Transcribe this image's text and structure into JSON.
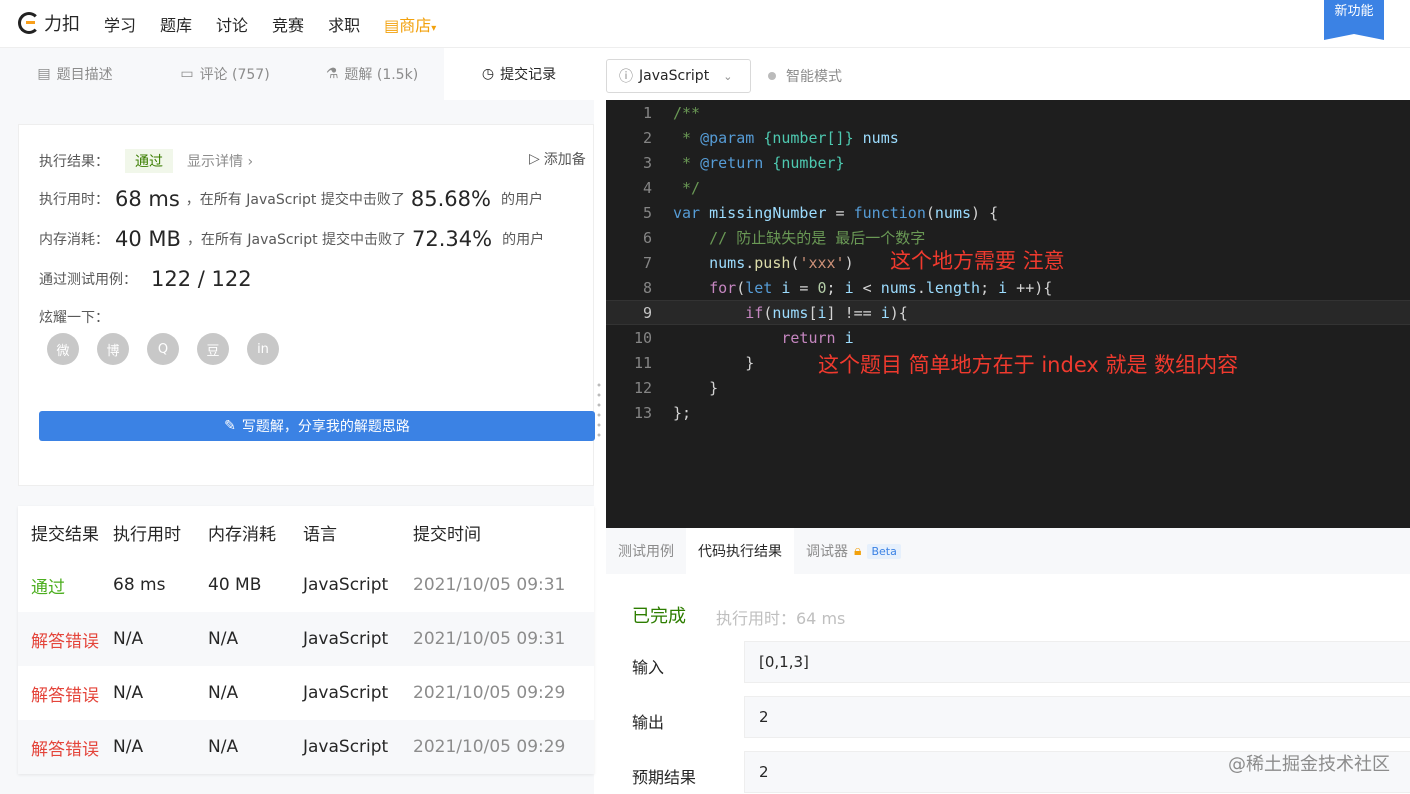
{
  "header": {
    "logo_text": "力扣",
    "nav": [
      "学习",
      "题库",
      "讨论",
      "竞赛",
      "求职"
    ],
    "shop_label": "商店",
    "new_feature": "新功能"
  },
  "left_tabs": [
    {
      "label": "题目描述",
      "icon": "doc-icon"
    },
    {
      "label": "评论 (757)",
      "icon": "comment-icon"
    },
    {
      "label": "题解 (1.5k)",
      "icon": "flask-icon"
    },
    {
      "label": "提交记录",
      "icon": "clock-icon"
    }
  ],
  "result_panel": {
    "exec_result_label": "执行结果：",
    "exec_result_value": "通过",
    "show_details": "显示详情",
    "add_note": "添加备",
    "time_label": "执行用时：",
    "time_value": "68 ms",
    "time_text": "，在所有 JavaScript 提交中击败了",
    "time_percent": "85.68%",
    "time_suffix": "的用户",
    "mem_label": "内存消耗：",
    "mem_value": "40 MB",
    "mem_text": "，在所有 JavaScript 提交中击败了",
    "mem_percent": "72.34%",
    "mem_suffix": "的用户",
    "cases_label": "通过测试用例：",
    "cases_value": "122 / 122",
    "share_label": "炫耀一下：",
    "social": [
      "微",
      "博",
      "Q",
      "豆",
      "in"
    ],
    "write_button": "写题解，分享我的解题思路"
  },
  "submissions": {
    "headers": [
      "提交结果",
      "执行用时",
      "内存消耗",
      "语言",
      "提交时间"
    ],
    "rows": [
      {
        "status": "通过",
        "time": "68 ms",
        "mem": "40 MB",
        "lang": "JavaScript",
        "date": "2021/10/05 09:31"
      },
      {
        "status": "解答错误",
        "time": "N/A",
        "mem": "N/A",
        "lang": "JavaScript",
        "date": "2021/10/05 09:31"
      },
      {
        "status": "解答错误",
        "time": "N/A",
        "mem": "N/A",
        "lang": "JavaScript",
        "date": "2021/10/05 09:29"
      },
      {
        "status": "解答错误",
        "time": "N/A",
        "mem": "N/A",
        "lang": "JavaScript",
        "date": "2021/10/05 09:29"
      }
    ]
  },
  "editor": {
    "language": "JavaScript",
    "smart_mode": "智能模式",
    "line_numbers": [
      "1",
      "2",
      "3",
      "4",
      "5",
      "6",
      "7",
      "8",
      "9",
      "10",
      "11",
      "12",
      "13"
    ],
    "annotation_1": "这个地方需要 注意",
    "annotation_2": "这个题目 简单地方在于 index 就是 数组内容"
  },
  "bottom_tabs": [
    "测试用例",
    "代码执行结果",
    "调试器",
    "Beta"
  ],
  "run_result": {
    "status": "已完成",
    "runtime": "执行用时：64 ms",
    "input_label": "输入",
    "input_value": "[0,1,3]",
    "output_label": "输出",
    "output_value": "2",
    "expected_label": "预期结果",
    "expected_value": "2"
  },
  "watermark": "@稀土掘金技术社区"
}
